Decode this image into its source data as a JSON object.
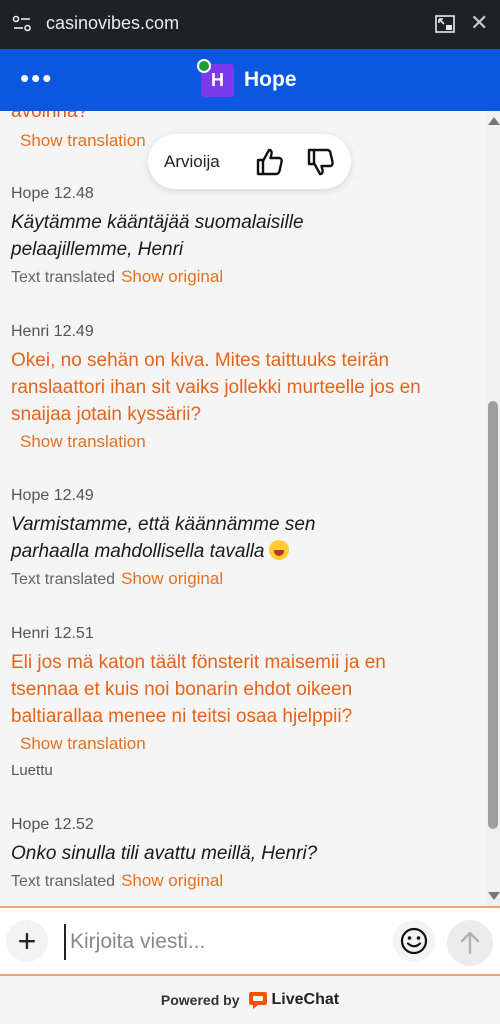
{
  "browser": {
    "url": "casinovibes.com"
  },
  "header": {
    "menu": "•••",
    "avatar_initial": "H",
    "agent_name": "Hope"
  },
  "rating": {
    "label": "Arvioija"
  },
  "top_fragment": {
    "text": "avoinna?",
    "link": "Show translation"
  },
  "messages": [
    {
      "meta": "Hope 12.48",
      "text": "Käytämme kääntäjää suomalaisille pelaajillemme, Henri",
      "foot_label": "Text translated",
      "foot_link": "Show original"
    },
    {
      "meta": "Henri 12.49",
      "text": "Okei, no sehän on kiva. Mites taittuuks teirän ranslaattori ihan sit vaiks jollekki murteelle jos en snaijaa jotain kyssärii?",
      "foot_link": "Show translation"
    },
    {
      "meta": "Hope 12.49",
      "text": "Varmistamme, että käännämme sen parhaalla mahdollisella tavalla",
      "foot_label": "Text translated",
      "foot_link": "Show original"
    },
    {
      "meta": "Henri 12.51",
      "text": "Eli jos mä katon täält fönsterit maisemii ja en tsennaa et kuis noi bonarin ehdot oikeen baltiarallaa menee ni teitsi osaa hjelppii?",
      "foot_link": "Show translation",
      "read": "Luettu"
    },
    {
      "meta": "Hope 12.52",
      "text": "Onko sinulla tili avattu meillä, Henri?",
      "foot_label": "Text translated",
      "foot_link": "Show original"
    }
  ],
  "composer": {
    "add": "+",
    "placeholder": "Kirjoita viesti..."
  },
  "footer": {
    "powered": "Powered by",
    "brand": "LiveChat"
  },
  "colors": {
    "brand_blue": "#0b57e0",
    "accent_orange": "#e8701f",
    "avatar_purple": "#7c3aed"
  }
}
